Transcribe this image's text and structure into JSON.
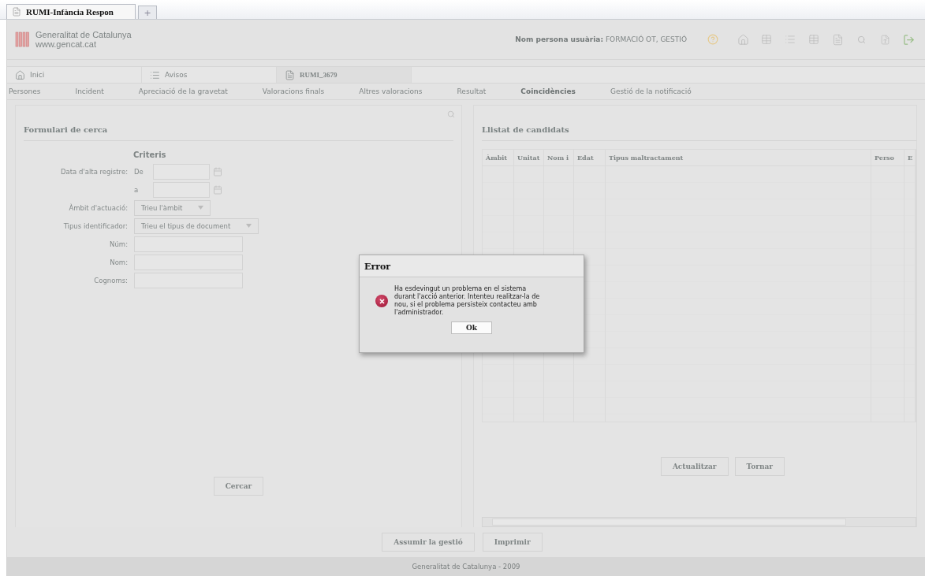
{
  "browser": {
    "tab_title": "RUMI-Infància Respon",
    "new_tab": "+"
  },
  "header": {
    "org_name": "Generalitat de Catalunya",
    "org_url": "www.gencat.cat",
    "user_label": "Nom persona usuària:",
    "user_name": "FORMACIÓ OT, GESTIÓ"
  },
  "tabs": [
    {
      "label": "Inici",
      "kind": "home",
      "selected": false
    },
    {
      "label": "Avisos",
      "kind": "list",
      "selected": false
    },
    {
      "label": "RUMI_3679",
      "kind": "doc",
      "selected": true
    }
  ],
  "subtabs": [
    {
      "label": "Persones",
      "selected": false
    },
    {
      "label": "Incident",
      "selected": false
    },
    {
      "label": "Apreciació de la gravetat",
      "selected": false
    },
    {
      "label": "Valoracions finals",
      "selected": false
    },
    {
      "label": "Altres valoracions",
      "selected": false
    },
    {
      "label": "Resultat",
      "selected": false
    },
    {
      "label": "Coincidències",
      "selected": true
    },
    {
      "label": "Gestió de la notificació",
      "selected": false
    }
  ],
  "search_form": {
    "title": "Formulari de cerca",
    "section": "Criteris",
    "rows": [
      {
        "kind": "date",
        "label": "Data d'alta registre:",
        "prefix": "De"
      },
      {
        "kind": "date",
        "prefix": "a"
      },
      {
        "kind": "select",
        "label": "Àmbit d'actuació:",
        "placeholder": "Trieu l'àmbit"
      },
      {
        "kind": "select",
        "label": "Tipus identificador:",
        "placeholder": "Trieu el tipus de document"
      },
      {
        "kind": "text",
        "label": "Núm:"
      },
      {
        "kind": "text",
        "label": "Nom:"
      },
      {
        "kind": "text",
        "label": "Cognoms:"
      }
    ],
    "button": "Cercar"
  },
  "candidates": {
    "title": "Llistat de candidats",
    "columns": [
      "Àmbit",
      "Unitat",
      "Nom i",
      "Edat",
      "Tipus maltractament",
      "Perso",
      "E"
    ],
    "buttons": [
      "Actualitzar",
      "Tornar"
    ]
  },
  "bottom_buttons": [
    "Assumir la gestió",
    "Imprimir"
  ],
  "footer": "Generalitat de Catalunya - 2009",
  "dialog": {
    "title": "Error",
    "message": "Ha esdevingut un problema en el sistema durant l'acció anterior. Intenteu realitzar-la de nou, si el problema persisteix contacteu amb l'administrador.",
    "button": "Ok"
  }
}
